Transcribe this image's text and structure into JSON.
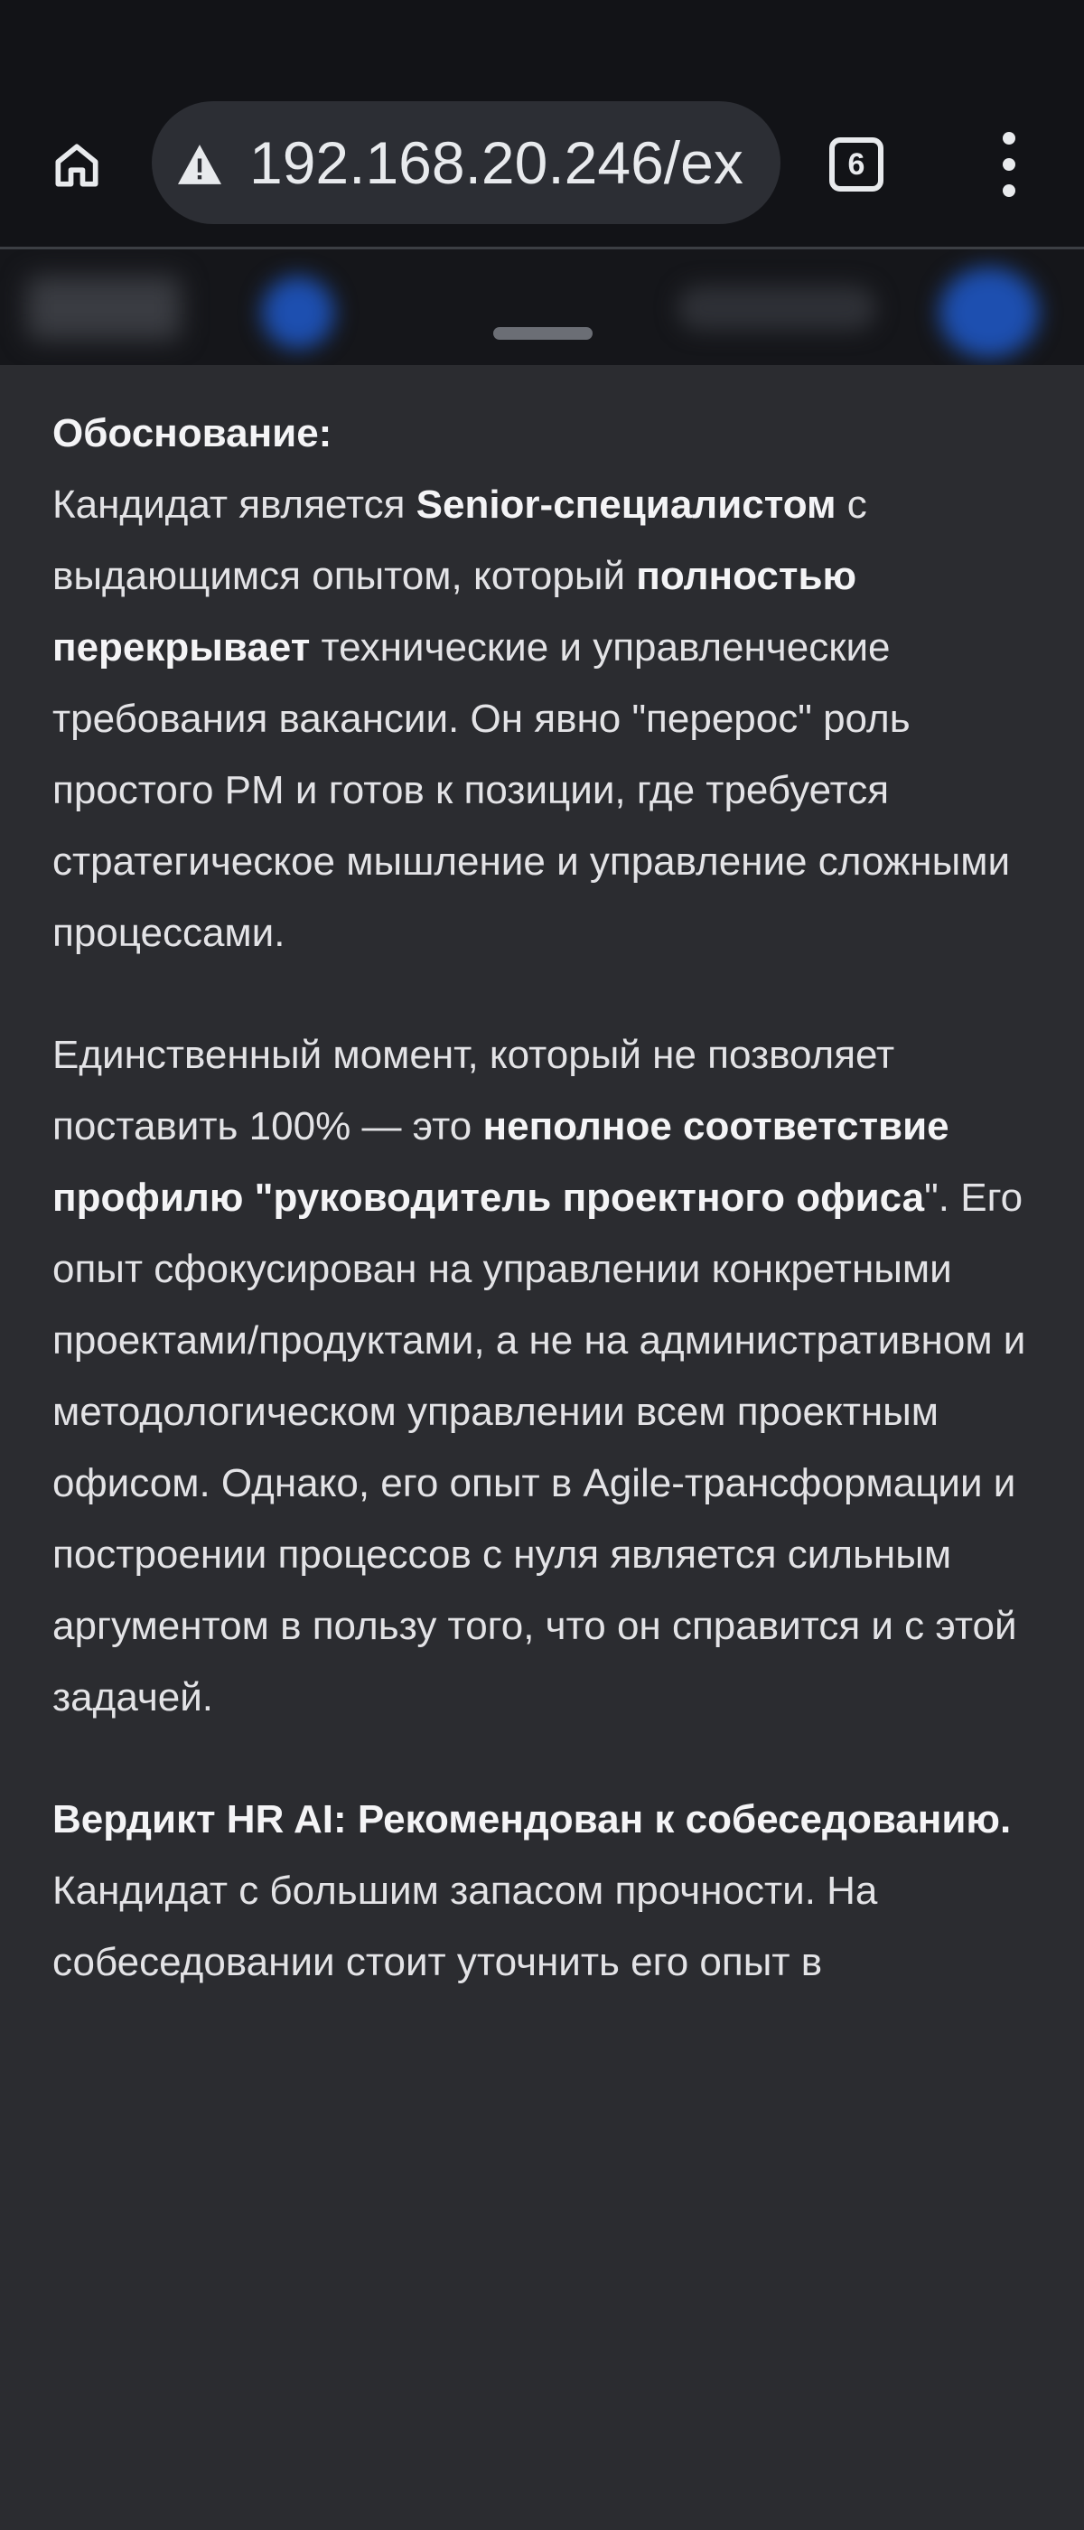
{
  "browser": {
    "url": "192.168.20.246/ex",
    "tab_count": "6",
    "icons": {
      "home": "home-icon",
      "warning": "warning-icon",
      "tabs": "tabs-icon",
      "menu": "more-vert-icon"
    }
  },
  "colors": {
    "toolbar_bg": "#121317",
    "sheet_bg": "#2b2c30",
    "text": "#e3e3e6"
  },
  "content": {
    "heading": "Обоснование:",
    "p1": {
      "a": "Кандидат является ",
      "b": "Senior-специалистом",
      "c": " с выдающимся опытом, который ",
      "d": "полностью перекрывает",
      "e": " технические и управленческие требования вакансии. Он явно \"перерос\" роль простого PM и готов к позиции, где требуется стратегическое мышление и управление сложными процессами."
    },
    "p2": {
      "a": "Единственный момент, который не позволяет поставить 100% — это ",
      "b": "неполное соответствие профилю \"руководитель проектного офиса",
      "c": "\". Его опыт сфокусирован на управлении конкретными проектами/продуктами, а не на административном и методологическом управлении всем проектным офисом. Однако, его опыт в Agile-трансформации и построении процессов с нуля является сильным аргументом в пользу того, что он справится и с этой задачей."
    },
    "p3": {
      "b": "Вердикт HR AI: Рекомендован к собеседованию.",
      "c": " Кандидат с большим запасом прочности. На собеседовании стоит уточнить его опыт в"
    }
  }
}
